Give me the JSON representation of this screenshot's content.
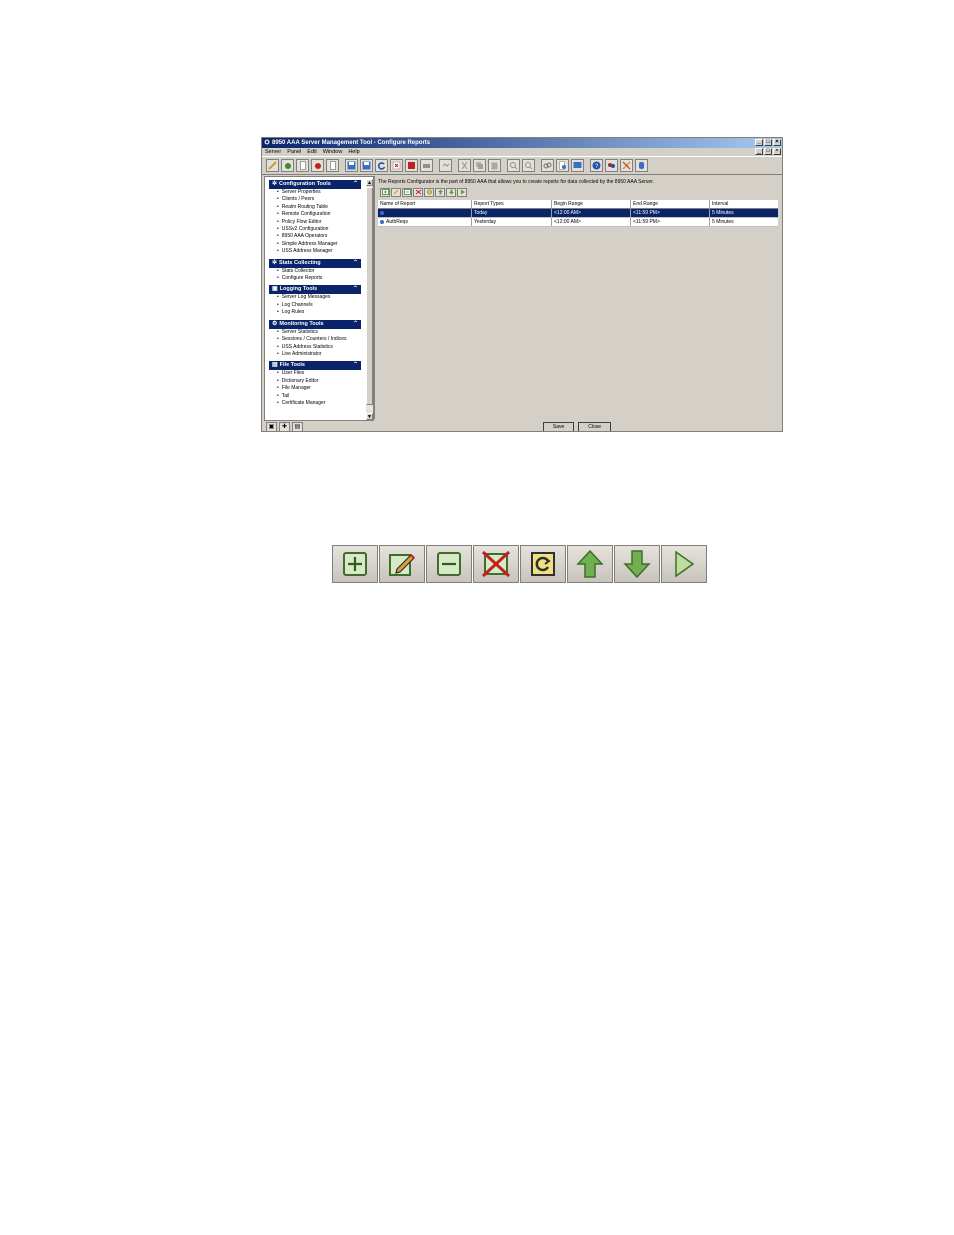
{
  "window": {
    "title": "8950 AAA Server Management Tool - Configure Reports",
    "controls": [
      "_",
      "□",
      "×"
    ]
  },
  "menubar": {
    "items": [
      "Server",
      "Panel",
      "Edit",
      "Window",
      "Help"
    ]
  },
  "sidebar": {
    "sections": [
      {
        "title": "Configuration Tools",
        "items": [
          "Server Properties",
          "Clients / Peers",
          "Realm Routing Table",
          "Remote Configuration",
          "Policy Flow Editor",
          "USSv2 Configuration",
          "8950 AAA Operators",
          "Simple Address Manager",
          "USS Address Manager"
        ]
      },
      {
        "title": "Stats Collecting",
        "items": [
          "Stats Collector",
          "Configure Reports"
        ]
      },
      {
        "title": "Logging Tools",
        "items": [
          "Server Log Messages",
          "Log Channels",
          "Log Rules"
        ]
      },
      {
        "title": "Monitoring Tools",
        "items": [
          "Server Statistics",
          "Sessions / Counters / Indices",
          "USS Address Statistics",
          "Live Administrator"
        ]
      },
      {
        "title": "File Tools",
        "items": [
          "User Files",
          "Dictionary Editor",
          "File Manager",
          "Tail",
          "Certificate Manager"
        ]
      }
    ]
  },
  "main": {
    "description": "The Reports Configurator is the part of 8950 AAA that allows you to create reports for data collected by the 8950 AAA Server.",
    "table": {
      "columns": [
        "Name of Report",
        "Report Types",
        "Begin Range",
        "End Range",
        "Interval"
      ],
      "rows": [
        [
          "",
          "Today",
          "<12:00 AM>",
          "<11:59 PM>",
          "5 Minutes"
        ],
        [
          "AuthReqs",
          "Yesterday",
          "<12:00 AM>",
          "<11:59 PM>",
          "5 Minutes"
        ]
      ]
    },
    "save_label": "Save",
    "close_label": "Close"
  },
  "icon_colors": {
    "green": "#3d8c2e",
    "red": "#c02020",
    "blue": "#0a246a"
  }
}
